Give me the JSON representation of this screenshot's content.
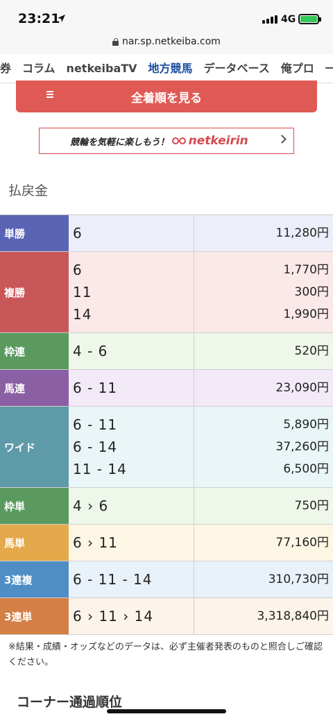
{
  "status_bar": {
    "time": "23:21",
    "network": "4G"
  },
  "browser": {
    "url": "nar.sp.netkeiba.com"
  },
  "nav": {
    "tabs": [
      {
        "label": "券",
        "active": false
      },
      {
        "label": "コラム",
        "active": false
      },
      {
        "label": "netkeibaTV",
        "active": false
      },
      {
        "label": "地方競馬",
        "active": true
      },
      {
        "label": "データベース",
        "active": false
      },
      {
        "label": "俺プロ",
        "active": false
      },
      {
        "label": "一",
        "active": false
      }
    ]
  },
  "all_results_button": "全着順を見る",
  "banner": {
    "text": "競輪を気軽に楽しもう！",
    "brand": "netkeirin"
  },
  "payout_title": "払戻金",
  "payouts": [
    {
      "label": "単勝",
      "color": "#5a64b5",
      "bg": "#eceff9",
      "combos": [
        "6"
      ],
      "amounts": [
        "11,280円"
      ]
    },
    {
      "label": "複勝",
      "color": "#c9575a",
      "bg": "#fbe9e9",
      "combos": [
        "6",
        "11",
        "14"
      ],
      "amounts": [
        "1,770円",
        "300円",
        "1,990円"
      ]
    },
    {
      "label": "枠連",
      "color": "#5a9a5f",
      "bg": "#eef7ea",
      "combos": [
        "4 - 6"
      ],
      "amounts": [
        "520円"
      ]
    },
    {
      "label": "馬連",
      "color": "#8a5fa3",
      "bg": "#f3eaf8",
      "combos": [
        "6 - 11"
      ],
      "amounts": [
        "23,090円"
      ]
    },
    {
      "label": "ワイド",
      "color": "#5f9aa8",
      "bg": "#e9f5f6",
      "combos": [
        "6 - 11",
        "6 - 14",
        "11 - 14"
      ],
      "amounts": [
        "5,890円",
        "37,260円",
        "6,500円"
      ]
    },
    {
      "label": "枠単",
      "color": "#5a9a5f",
      "bg": "#eef7ea",
      "combos": [
        "4 › 6"
      ],
      "amounts": [
        "750円"
      ]
    },
    {
      "label": "馬単",
      "color": "#e4a94a",
      "bg": "#fdf6e4",
      "combos": [
        "6 › 11"
      ],
      "amounts": [
        "77,160円"
      ]
    },
    {
      "label": "3連複",
      "color": "#4f8ec4",
      "bg": "#e9f1f9",
      "combos": [
        "6 - 11 - 14"
      ],
      "amounts": [
        "310,730円"
      ]
    },
    {
      "label": "3連単",
      "color": "#d47f45",
      "bg": "#fcf4ea",
      "combos": [
        "6 › 11 › 14"
      ],
      "amounts": [
        "3,318,840円"
      ]
    }
  ],
  "note": "※結果・成績・オッズなどのデータは、必ず主催者発表のものと照合しご確認ください。",
  "corner_title": "コーナー通過順位"
}
